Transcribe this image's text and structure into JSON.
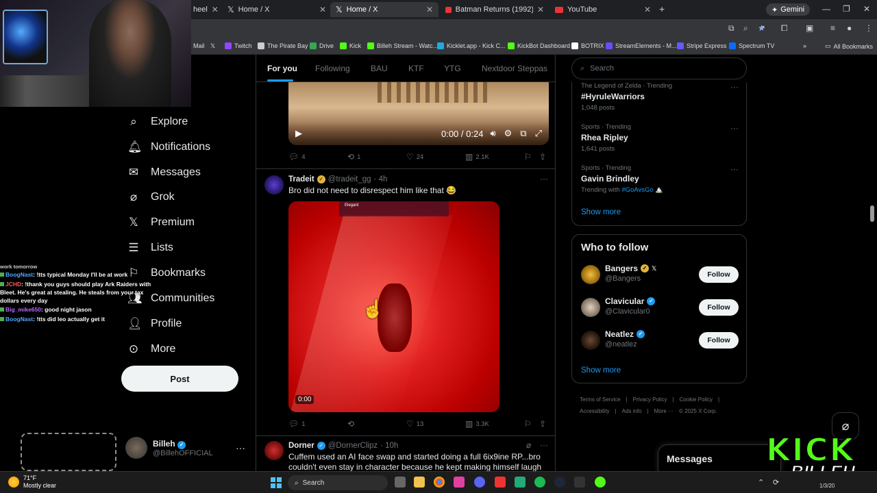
{
  "browser": {
    "tabs": [
      {
        "label": "heel",
        "active": false
      },
      {
        "label": "Home / X",
        "active": false
      },
      {
        "label": "Home / X",
        "active": true
      },
      {
        "label": "Batman Returns (1992) Trailer #",
        "active": false
      },
      {
        "label": "YouTube",
        "active": false
      }
    ],
    "gemini_label": "Gemini",
    "bookmarks": [
      {
        "label": "Mail",
        "color": "#777"
      },
      {
        "label": "",
        "color": "#000"
      },
      {
        "label": "Twitch",
        "color": "#9146ff"
      },
      {
        "label": "The Pirate Bay",
        "color": "#ccc"
      },
      {
        "label": "Drive",
        "color": "#34a853"
      },
      {
        "label": "Kick",
        "color": "#53fc18"
      },
      {
        "label": "Billeh Stream - Watc...",
        "color": "#53fc18"
      },
      {
        "label": "Kicklet.app - Kick C...",
        "color": "#2ad"
      },
      {
        "label": "KickBot Dashboard",
        "color": "#53fc18"
      },
      {
        "label": "BOTRIX",
        "color": "#fff"
      },
      {
        "label": "StreamElements - M...",
        "color": "#6a4cff"
      },
      {
        "label": "Stripe Express",
        "color": "#635bff"
      },
      {
        "label": "Spectrum TV",
        "color": "#0a6cff"
      }
    ],
    "all_bookmarks": "All Bookmarks"
  },
  "sidebar": {
    "items": [
      {
        "label": "Explore",
        "icon": "search-icon"
      },
      {
        "label": "Notifications",
        "icon": "bell-icon"
      },
      {
        "label": "Messages",
        "icon": "mail-icon"
      },
      {
        "label": "Grok",
        "icon": "grok-icon"
      },
      {
        "label": "Premium",
        "icon": "x-icon"
      },
      {
        "label": "Lists",
        "icon": "list-icon"
      },
      {
        "label": "Bookmarks",
        "icon": "bookmark-icon"
      },
      {
        "label": "Communities",
        "icon": "people-icon"
      },
      {
        "label": "Profile",
        "icon": "person-icon"
      },
      {
        "label": "More",
        "icon": "more-circle-icon"
      }
    ],
    "post_label": "Post",
    "account": {
      "name": "Billeh",
      "handle": "@BillehOFFICIAL"
    }
  },
  "chat_overlay": {
    "lines": [
      {
        "user": "",
        "text": "work tomorrow"
      },
      {
        "user": "BoogNast",
        "text": ": !tts typical Monday I'll be at work"
      },
      {
        "user": "JCHD",
        "text": ": !thank you guys should play Ark Raiders with Bleet. He's great at stealing. He steals from your tax dollars every day"
      },
      {
        "user": "Big_mike650",
        "text": ": good night jason"
      },
      {
        "user": "BoogNast",
        "text": ": !tts did leo actually get it"
      }
    ]
  },
  "feed": {
    "tabs": [
      "For you",
      "Following",
      "BAU",
      "KTF",
      "YTG",
      "Nextdoor Steppas"
    ],
    "video1": {
      "time": "0:00 / 0:24"
    },
    "tweet1_actions": {
      "replies": "4",
      "reposts": "1",
      "likes": "24",
      "views": "2.1K"
    },
    "tweet2": {
      "name": "Tradeit",
      "handle": "@tradeit_gg",
      "time": "· 4h",
      "text": "Bro did not need to disrespect him like that 😂",
      "video_overlay": "Elegant",
      "video_time": "0:00",
      "replies": "1",
      "reposts": "",
      "likes": "13",
      "views": "3.3K"
    },
    "tweet3": {
      "name": "Dorner",
      "handle": "@DornerClipz",
      "time": "· 10h",
      "text": "Cuffem used an AI face swap and started doing a full 6ix9ine RP...bro couldn't even stay in character because he kept making himself laugh 😭"
    }
  },
  "right": {
    "search_placeholder": "Search",
    "trends": [
      {
        "meta": "The Legend of Zelda · Trending",
        "title": "#HyruleWarriors",
        "count": "1,048 posts",
        "link": ""
      },
      {
        "meta": "Sports · Trending",
        "title": "Rhea Ripley",
        "count": "1,641 posts",
        "link": ""
      },
      {
        "meta": "Sports · Trending",
        "title": "Gavin Brindley",
        "count": "Trending with ",
        "link": "#GoAvsGo 🏔️"
      }
    ],
    "show_more": "Show more",
    "who_to_follow_title": "Who to follow",
    "who_to_follow": [
      {
        "name": "Bangers",
        "handle": "@Bangers",
        "badge": "gold"
      },
      {
        "name": "Clavicular",
        "handle": "@Clavicular0",
        "badge": "blue"
      },
      {
        "name": "Neatlez",
        "handle": "@neatlez",
        "badge": "blue"
      }
    ],
    "follow_label": "Follow",
    "footer": [
      "Terms of Service",
      "|",
      "Privacy Policy",
      "|",
      "Cookie Policy",
      "|",
      "Accessibility",
      "|",
      "Ads info",
      "|",
      "More ···",
      "© 2025 X Corp."
    ],
    "messages_label": "Messages"
  },
  "kick_logo": {
    "line1": "KICK",
    "line2": "BILLEH"
  },
  "taskbar": {
    "temp": "71°F",
    "condition": "Mostly clear",
    "search_label": "Search",
    "clock": "1/3/20"
  }
}
